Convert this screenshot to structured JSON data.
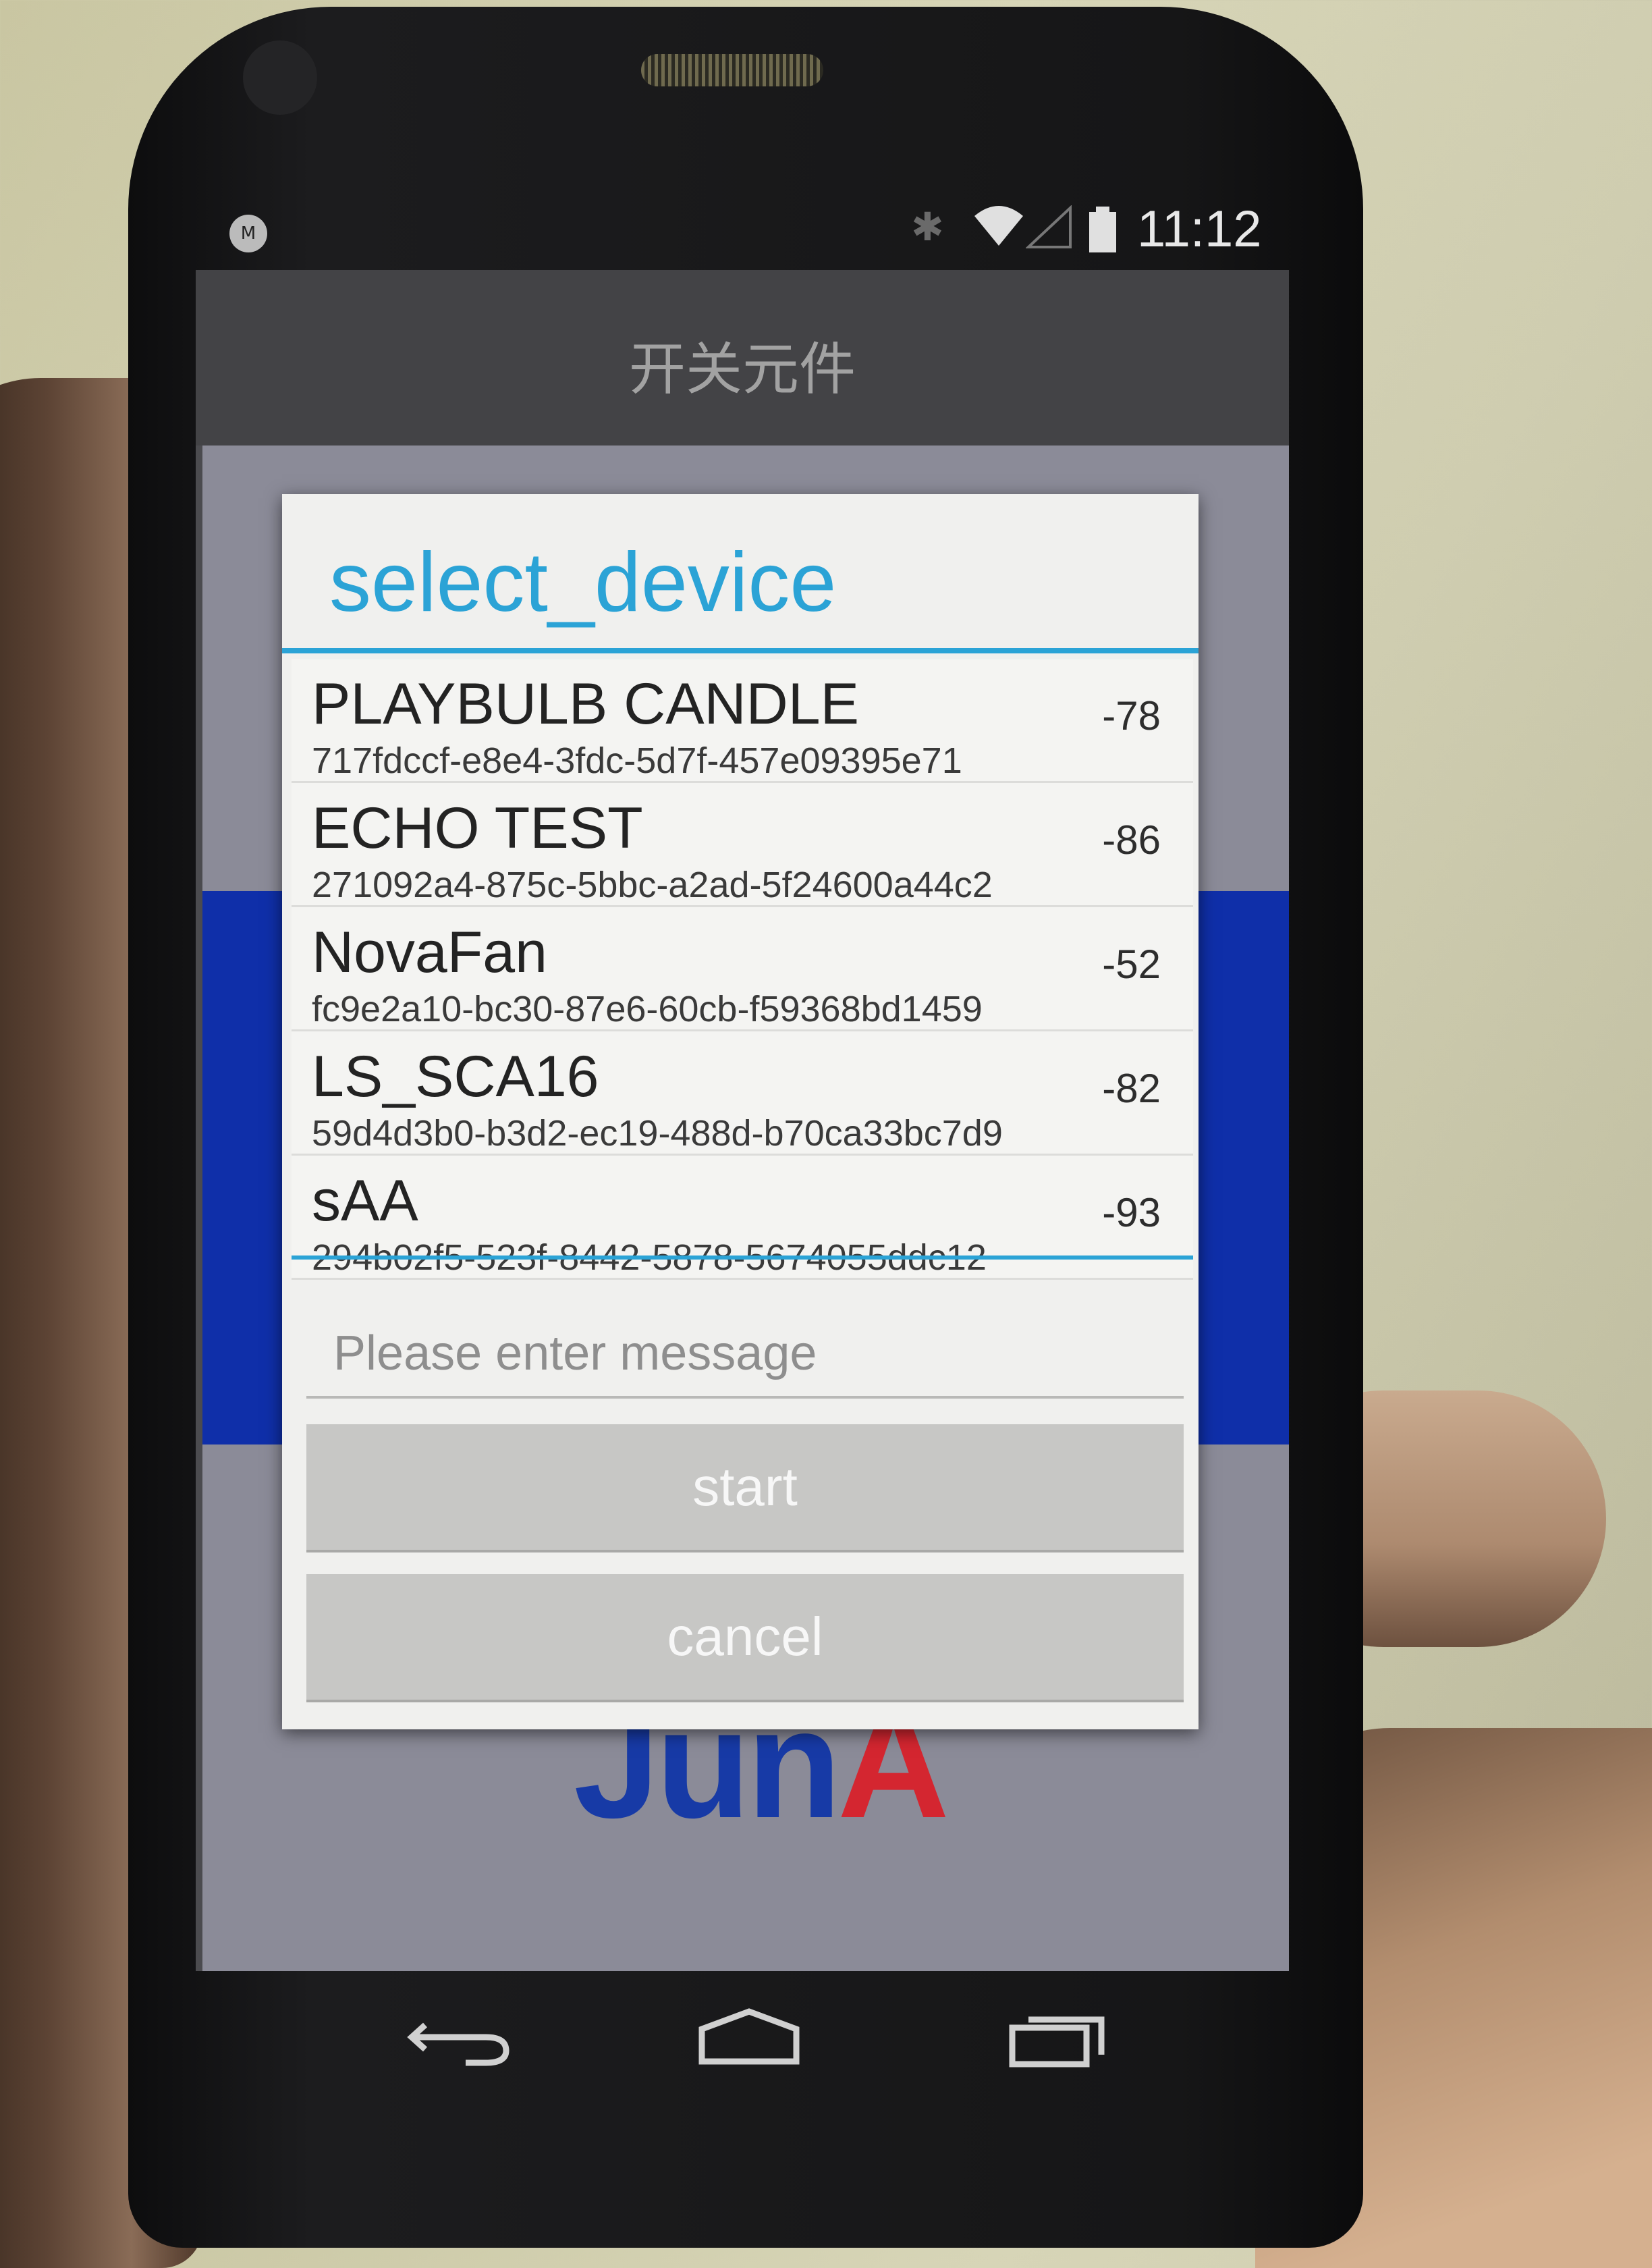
{
  "status_bar": {
    "time": "11:12",
    "icons": [
      "bluetooth-icon",
      "wifi-icon",
      "signal-icon",
      "battery-icon"
    ]
  },
  "app": {
    "title": "开关元件"
  },
  "dialog": {
    "title": "select_device",
    "devices": [
      {
        "name": "PLAYBULB CANDLE",
        "id": "717fdccf-e8e4-3fdc-5d7f-457e09395e71",
        "rssi": "-78"
      },
      {
        "name": "ECHO TEST",
        "id": "271092a4-875c-5bbc-a2ad-5f24600a44c2",
        "rssi": "-86"
      },
      {
        "name": "NovaFan",
        "id": "fc9e2a10-bc30-87e6-60cb-f59368bd1459",
        "rssi": "-52"
      },
      {
        "name": "LS_SCA16",
        "id": "59d4d3b0-b3d2-ec19-488d-b70ca33bc7d9",
        "rssi": "-82"
      },
      {
        "name": "sAA",
        "id": "294b02f5-523f-8442-5878-5674055ddc12",
        "rssi": "-93"
      }
    ],
    "message_placeholder": "Please enter message",
    "start_label": "start",
    "cancel_label": "cancel"
  },
  "background_logo": {
    "main": "Jun",
    "accent": "A"
  },
  "nav_bar": {
    "icons": [
      "back-icon",
      "home-icon",
      "recents-icon"
    ]
  },
  "colors": {
    "accent": "#2ba3d6",
    "button": "#c7c7c5",
    "band": "#0f2fa9"
  }
}
